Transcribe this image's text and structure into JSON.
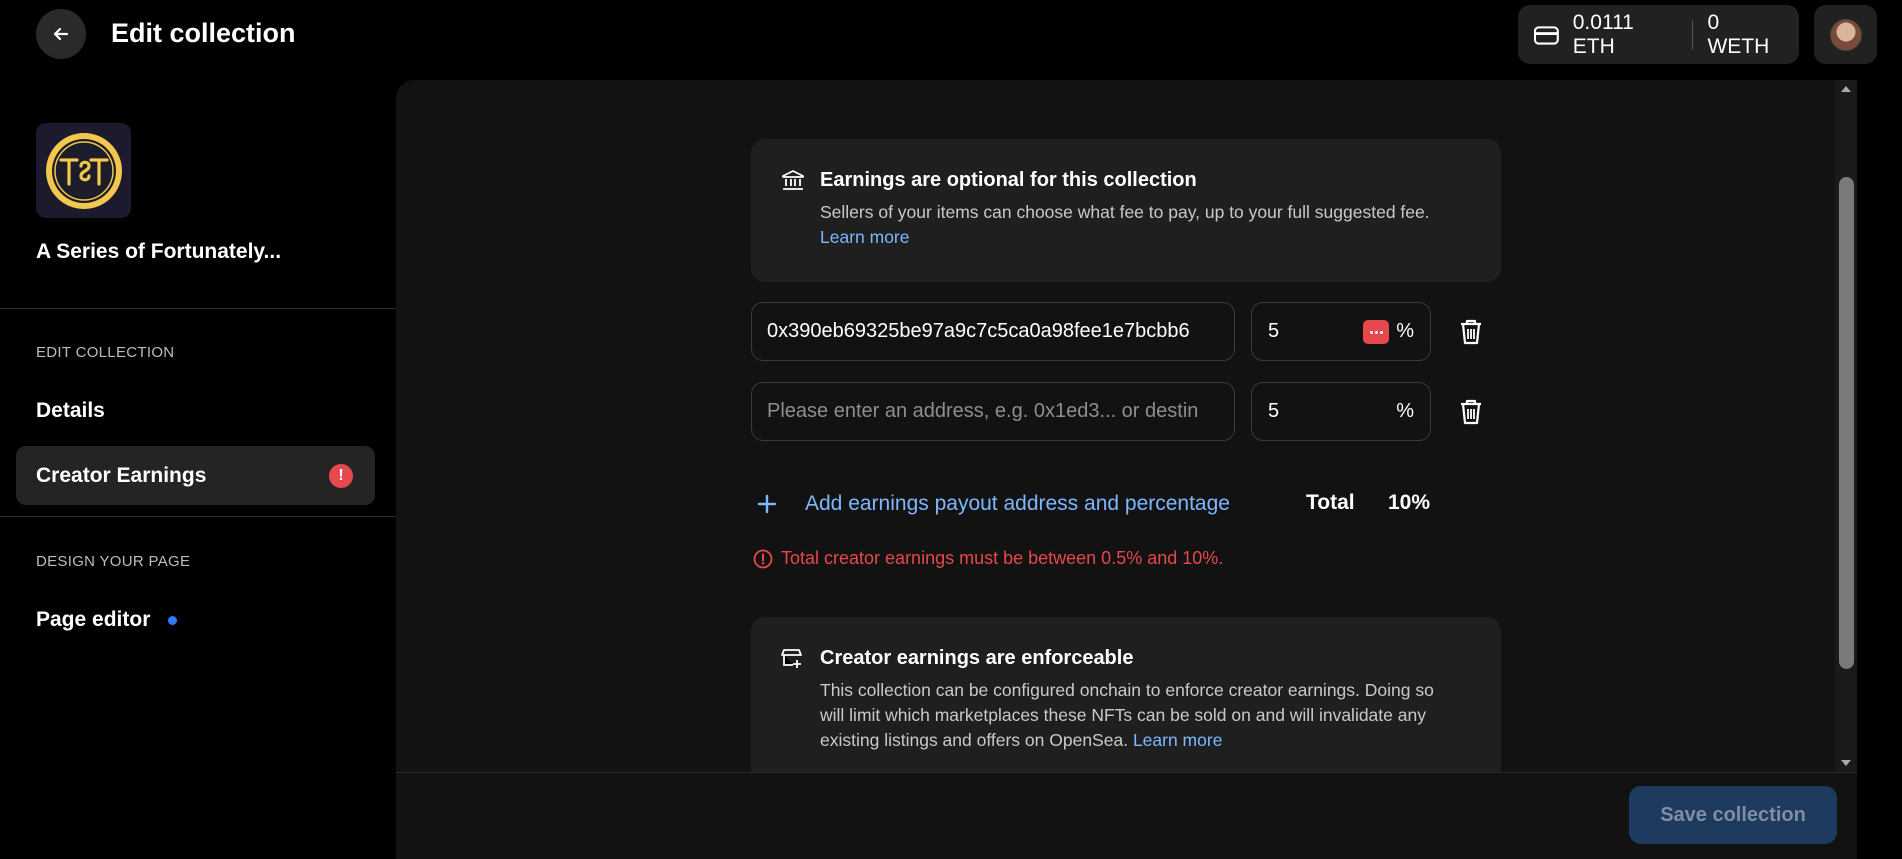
{
  "header": {
    "title": "Edit collection",
    "back_icon": "arrow-left-icon"
  },
  "wallet": {
    "eth_balance": "0.0111 ETH",
    "weth_balance": "0 WETH"
  },
  "sidebar": {
    "collection_name": "A Series of Fortunately...",
    "section_edit": "EDIT COLLECTION",
    "items": [
      {
        "label": "Details"
      },
      {
        "label": "Creator Earnings",
        "badge": "!"
      }
    ],
    "section_design": "DESIGN YOUR PAGE",
    "page_editor": "Page editor"
  },
  "main": {
    "optional_card": {
      "title": "Earnings are optional for this collection",
      "body": "Sellers of your items can choose what fee to pay, up to your full suggested fee.",
      "link": "Learn more"
    },
    "payouts": [
      {
        "address": "0x390eb69325be97a9c7c5ca0a98fee1e7bcbb6",
        "percent": "5",
        "percent_sign": "%"
      },
      {
        "address_placeholder": "Please enter an address, e.g. 0x1ed3... or destin",
        "percent": "5",
        "percent_sign": "%"
      }
    ],
    "add_label": "Add earnings payout address and percentage",
    "total_label": "Total",
    "total_value": "10%",
    "error_message": "Total creator earnings must be between 0.5% and 10%.",
    "enforce_card": {
      "title": "Creator earnings are enforceable",
      "body": "This collection can be configured onchain to enforce creator earnings. Doing so will limit which marketplaces these NFTs can be sold on and will invalidate any existing listings and offers on OpenSea.",
      "link": "Learn more"
    },
    "save_label": "Save collection"
  },
  "colors": {
    "accent_link": "#7db8ff",
    "error": "#e5484d",
    "save_button_bg": "#1e3a5f",
    "notification_dot": "#2f7cf6"
  }
}
